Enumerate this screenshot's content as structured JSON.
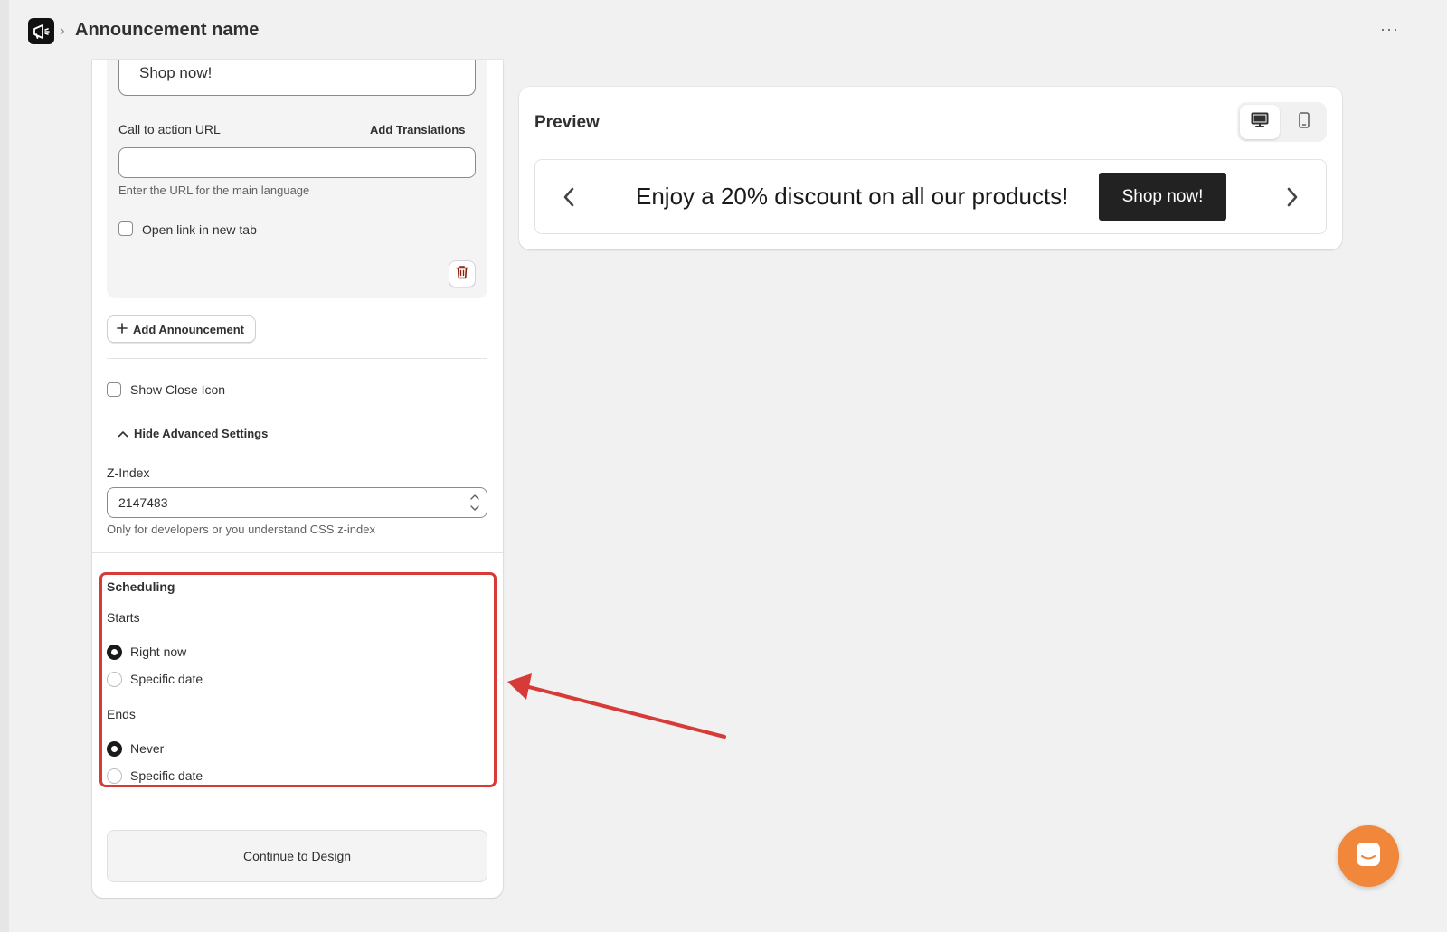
{
  "header": {
    "title": "Announcement name",
    "separator": "›",
    "more_label": "···"
  },
  "editor": {
    "cta_text_value": "Shop now!",
    "cta_url": {
      "label": "Call to action URL",
      "translations_link": "Add Translations",
      "value": "",
      "placeholder": "",
      "help": "Enter the URL for the main language"
    },
    "open_new_tab_label": "Open link in new tab",
    "add_announcement_label": "Add Announcement",
    "show_close_icon_label": "Show Close Icon",
    "advanced_toggle_label": "Hide Advanced Settings",
    "z_index": {
      "label": "Z-Index",
      "value": "2147483",
      "help": "Only for developers or you understand CSS z-index"
    },
    "scheduling": {
      "title": "Scheduling",
      "starts_label": "Starts",
      "starts_options": [
        "Right now",
        "Specific date"
      ],
      "starts_selected": 0,
      "ends_label": "Ends",
      "ends_options": [
        "Never",
        "Specific date"
      ],
      "ends_selected": 0
    },
    "continue_label": "Continue to Design"
  },
  "preview": {
    "title": "Preview",
    "announcement_text": "Enjoy a 20% discount on all our products!",
    "button_label": "Shop now!",
    "active_device": "desktop"
  },
  "colors": {
    "annotation_red": "#d63b37",
    "chat_orange": "#f0873a",
    "preview_button_bg": "#222222",
    "delete_red": "#8e1f0b"
  },
  "icons": {
    "app_logo": "megaphone-icon",
    "delete": "trash-icon",
    "add": "plus-icon",
    "advanced_toggle": "chevron-up-icon",
    "desktop": "desktop-icon",
    "mobile": "mobile-icon",
    "prev": "chevron-left-icon",
    "next": "chevron-right-icon",
    "chat": "chat-icon"
  }
}
